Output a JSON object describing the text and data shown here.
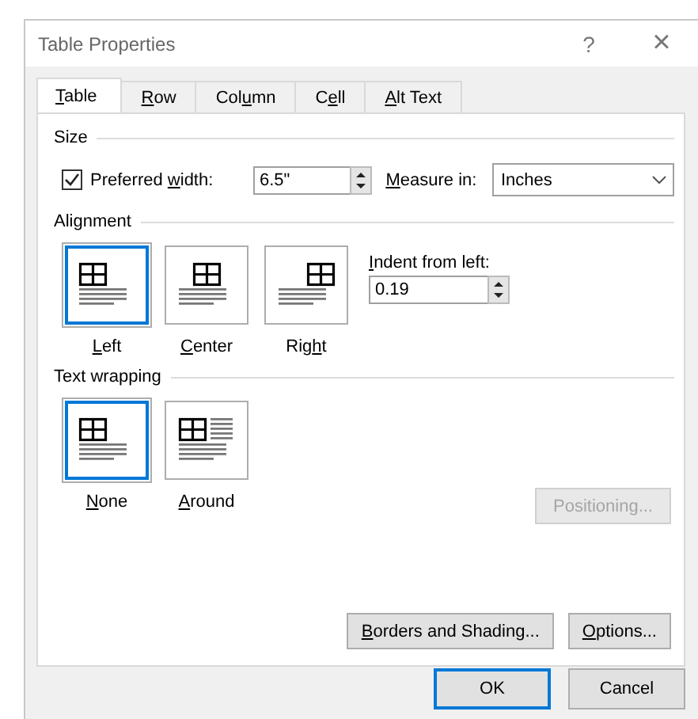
{
  "window": {
    "title": "Table Properties",
    "help": "?",
    "close": "×"
  },
  "tabs": [
    {
      "label": "Table",
      "selected": true
    },
    {
      "label": "Row",
      "selected": false
    },
    {
      "label": "Column",
      "selected": false
    },
    {
      "label": "Cell",
      "selected": false
    },
    {
      "label": "Alt Text",
      "selected": false
    }
  ],
  "size": {
    "heading": "Size",
    "preferred_width": {
      "label": "Preferred width:",
      "checked": true,
      "value": "6.5\""
    },
    "measure_in": {
      "label": "Measure in:",
      "value": "Inches"
    }
  },
  "alignment": {
    "heading": "Alignment",
    "options": [
      {
        "kind": "left",
        "label": "Left",
        "selected": true
      },
      {
        "kind": "center",
        "label": "Center",
        "selected": false
      },
      {
        "kind": "right",
        "label": "Right",
        "selected": false
      }
    ],
    "indent": {
      "label": "Indent from left:",
      "value": "0.19"
    }
  },
  "text_wrapping": {
    "heading": "Text wrapping",
    "options": [
      {
        "kind": "none",
        "label": "None",
        "selected": true
      },
      {
        "kind": "around",
        "label": "Around",
        "selected": false
      }
    ],
    "positioning": {
      "label": "Positioning...",
      "disabled": true
    }
  },
  "panel_buttons": [
    {
      "label": "Borders and Shading..."
    },
    {
      "label": "Options..."
    }
  ],
  "buttons": [
    {
      "label": "OK",
      "default": true
    },
    {
      "label": "Cancel",
      "default": false
    }
  ]
}
